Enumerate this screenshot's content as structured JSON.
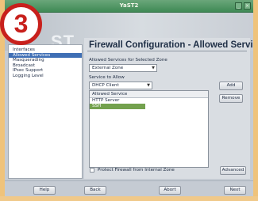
{
  "window": {
    "title": "YaST2",
    "controls": [
      "_",
      "×"
    ]
  },
  "step_badge": "3",
  "brand": {
    "left": "ST",
    "right": "ST"
  },
  "sidebar": {
    "items": [
      {
        "label": "Interfaces",
        "selected": false
      },
      {
        "label": "Allowed Services",
        "selected": true
      },
      {
        "label": "Masquerading",
        "selected": false
      },
      {
        "label": "Broadcast",
        "selected": false
      },
      {
        "label": "IPsec Support",
        "selected": false
      },
      {
        "label": "Logging Level",
        "selected": false
      }
    ]
  },
  "panel": {
    "title": "Firewall Configuration - Allowed Services",
    "zone_label": "Allowed Services for Selected Zone",
    "zone_value": "External Zone",
    "service_label": "Service to Allow",
    "service_value": "DHCP Client",
    "add_label": "Add",
    "remove_label": "Remove",
    "list_header": "Allowed Service",
    "services": [
      {
        "name": "HTTP Server",
        "selected": false
      },
      {
        "name": "SSH",
        "selected": true
      }
    ],
    "protect_label": "Protect Firewall from Internal Zone",
    "advanced_label": "Advanced"
  },
  "footer": {
    "help_label": "Help",
    "back_label": "Back",
    "abort_label": "Abort",
    "next_label": "Next"
  },
  "colors": {
    "badge": "#c8201c",
    "titlebar": "#3f8a55",
    "selected_sidebar": "#3f6fb5",
    "selected_row": "#73a14e"
  }
}
